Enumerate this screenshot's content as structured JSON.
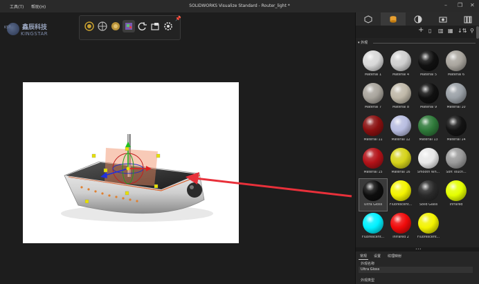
{
  "menu": {
    "tools": "工具(T)",
    "help": "帮助(H)"
  },
  "app_title": "SOLIDWORKS Visualize Standard - Router_light *",
  "window_controls": {
    "minimize": "–",
    "restore": "❐",
    "close": "✕"
  },
  "logo": {
    "kst": "KST",
    "cn": "鑫辰科技",
    "en": "KINGSTAR"
  },
  "toolbar": {
    "icons": [
      "sun-icon",
      "environment-icon",
      "model-icon",
      "material-icon",
      "rotate-icon",
      "camera-icon",
      "settings-icon"
    ]
  },
  "panel": {
    "tabs": [
      "model-icon",
      "appearance-icon",
      "scene-icon",
      "camera-icon",
      "library-icon"
    ],
    "tools": {
      "add": "+",
      "sort": "↓⇅",
      "search": "⚲"
    },
    "section_label": "▾ 外观",
    "materials": [
      {
        "label": "Material 1",
        "color": "#d8d8d8"
      },
      {
        "label": "Material 4",
        "color": "#cfcfcf"
      },
      {
        "label": "Material 5",
        "color": "#111111"
      },
      {
        "label": "Material 6",
        "color": "#a9a59e"
      },
      {
        "label": "Material 7",
        "color": "#a8a49c"
      },
      {
        "label": "Material 8",
        "color": "#bfb8a8"
      },
      {
        "label": "Material 9",
        "color": "#111111"
      },
      {
        "label": "Material 10",
        "color": "#9aa0a6"
      },
      {
        "label": "Material 11",
        "color": "#8a1010"
      },
      {
        "label": "Material 12",
        "color": "#b8bde0"
      },
      {
        "label": "Material 13",
        "color": "#2f7a3a"
      },
      {
        "label": "Material 14",
        "color": "#141414"
      },
      {
        "label": "Material 15",
        "color": "#b31218"
      },
      {
        "label": "Material 16",
        "color": "#d6d31a"
      },
      {
        "label": "Smooth Wh...",
        "color": "#e8e8e8"
      },
      {
        "label": "Soft Touch...",
        "color": "#9a9a9a"
      },
      {
        "label": "Ultra Gloss",
        "color": "#0e0e0e"
      },
      {
        "label": "Fluorescent...",
        "color": "#f3f300"
      },
      {
        "label": "Solid Glass",
        "color": "#2a2a2a"
      },
      {
        "label": "Infrared",
        "color": "#e4ff00"
      },
      {
        "label": "Fluorescent...",
        "color": "#00f0ff"
      },
      {
        "label": "Infrared 2",
        "color": "#f00a0a"
      },
      {
        "label": "Fluorescent...",
        "color": "#f3f300"
      }
    ],
    "selected_index": 16,
    "props_tabs": [
      "常规",
      "设置",
      "纹理映射"
    ],
    "prop_name_label": "外观名称",
    "prop_name_value": "Ultra Gloss",
    "prop_type_label": "外观类型"
  },
  "colors": {
    "accent_red": "#e8303a",
    "bg": "#1b1b1b"
  }
}
